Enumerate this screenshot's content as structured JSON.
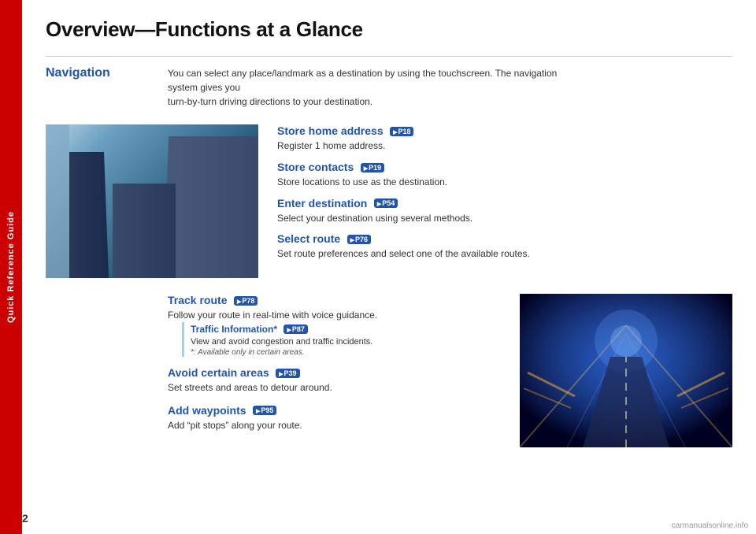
{
  "sidebar": {
    "label": "Quick Reference Guide"
  },
  "page": {
    "title": "Overview—Functions at a Glance",
    "number": "2"
  },
  "navigation": {
    "label": "Navigation",
    "description_line1": "You can select any place/landmark as a destination by using the touchscreen. The navigation system gives you",
    "description_line2": "turn-by-turn driving directions to your destination."
  },
  "upper_features": [
    {
      "title": "Store home address",
      "badge": "P18",
      "description": "Register 1 home address."
    },
    {
      "title": "Store contacts",
      "badge": "P19",
      "description": "Store locations to use as the destination."
    },
    {
      "title": "Enter destination",
      "badge": "P54",
      "description": "Select your destination using several methods."
    },
    {
      "title": "Select route",
      "badge": "P76",
      "description": "Set route preferences and select one of the available routes."
    }
  ],
  "lower_features": [
    {
      "title": "Track route",
      "badge": "P78",
      "description": "Follow your route in real-time with voice guidance.",
      "sub_feature": {
        "title": "Traffic Information*",
        "badge": "P87",
        "description": "View and avoid congestion and traffic incidents.",
        "note": "*: Available only in certain areas."
      }
    },
    {
      "title": "Avoid certain areas",
      "badge": "P39",
      "description": "Set streets and areas to detour around."
    },
    {
      "title": "Add waypoints",
      "badge": "P95",
      "description": "Add “pit stops” along your route."
    }
  ],
  "watermark": "carmanualsonline.info"
}
